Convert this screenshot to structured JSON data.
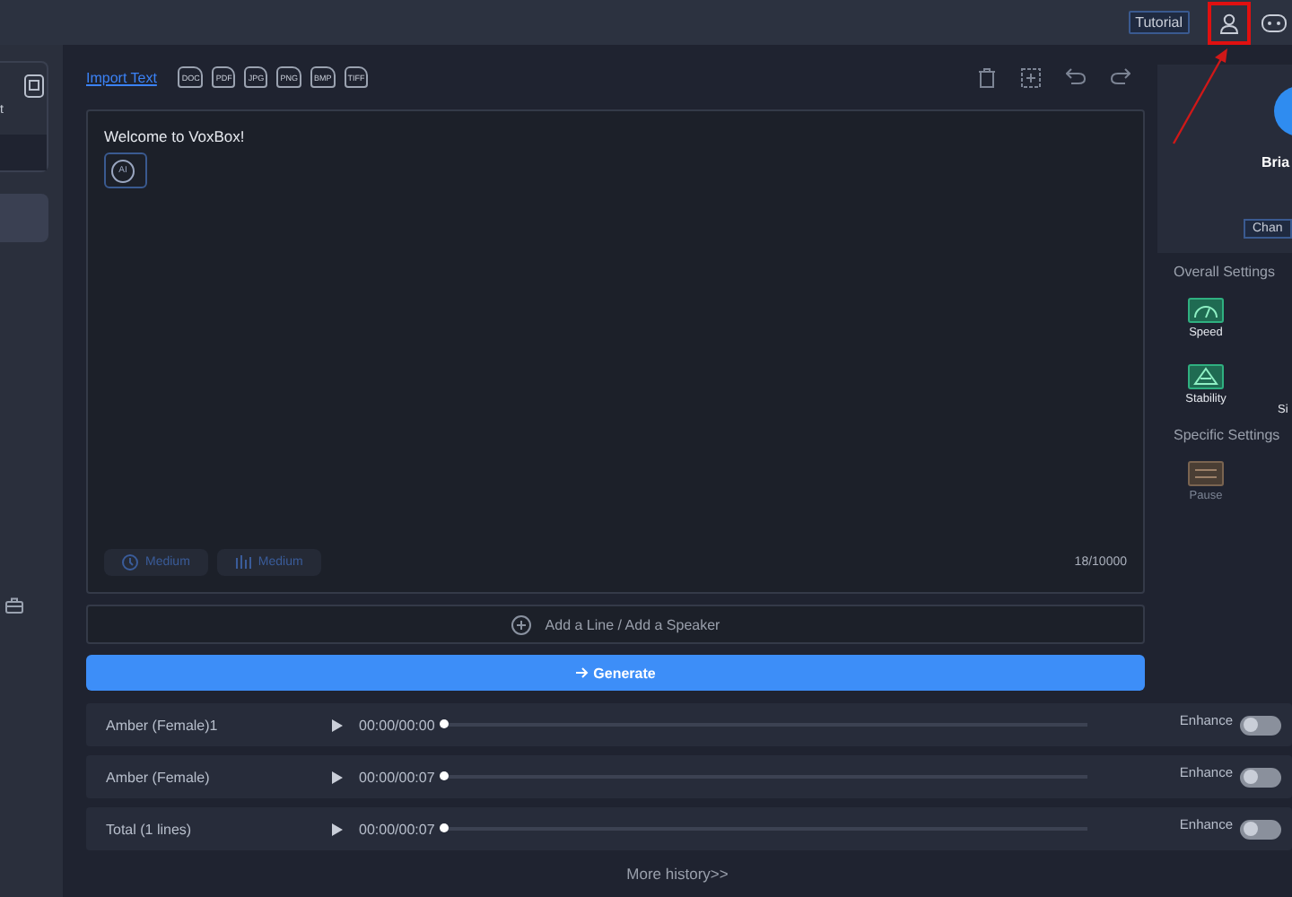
{
  "top_bar": {
    "tutorial_button": "Tutorial"
  },
  "sidebar": {
    "card_label": "t",
    "items": [
      {
        "selected": true
      }
    ]
  },
  "editor": {
    "import_link": "Import Text",
    "file_types": [
      "DOC",
      "PDF",
      "JPG",
      "PNG",
      "BMP",
      "TIFF"
    ],
    "text": "Welcome to VoxBox!",
    "voice_chip": "AI",
    "chips": [
      {
        "kind": "speed",
        "label": "Medium"
      },
      {
        "kind": "pitch",
        "label": "Medium"
      }
    ],
    "char_count": "18/10000",
    "add_line": "Add a Line / Add a Speaker",
    "generate_button": "Generate"
  },
  "profile": {
    "name": "Bria",
    "change_button": "Chan"
  },
  "settings": {
    "overall_title": "Overall Settings",
    "overall": [
      {
        "kind": "speed",
        "label": "Speed"
      },
      {
        "kind": "stability",
        "label": "Stability"
      }
    ],
    "overall_cut_label": "Si",
    "specific_title": "Specific Settings",
    "specific": [
      {
        "kind": "pause",
        "label": "Pause"
      }
    ]
  },
  "history": [
    {
      "name": "Amber (Female)1",
      "time": "00:00/00:00",
      "level": 0,
      "enhance_label": "Enhance",
      "enhance": false
    },
    {
      "name": "Amber (Female)",
      "time": "00:00/00:07",
      "level": 0,
      "enhance_label": "Enhance",
      "enhance": false
    },
    {
      "name": "Total (1 lines)",
      "time": "00:00/00:07",
      "level": 0,
      "enhance_label": "Enhance",
      "enhance": false
    }
  ],
  "more_history": "More history>>"
}
